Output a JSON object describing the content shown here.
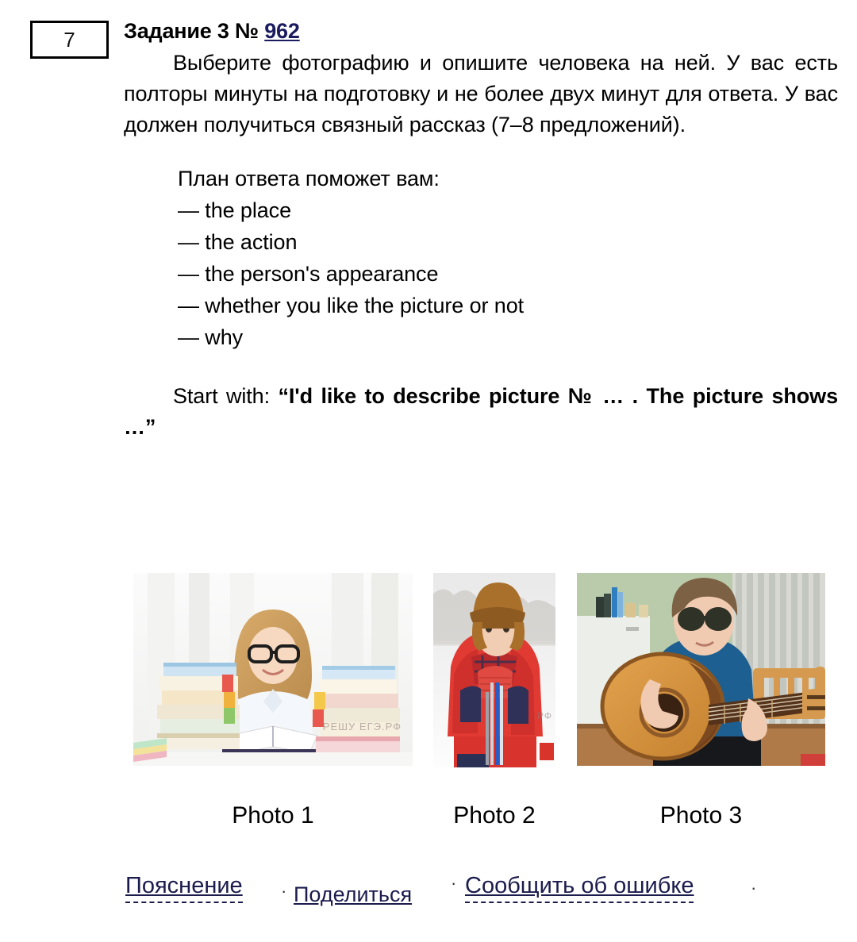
{
  "task": {
    "number_box": "7",
    "heading_prefix": "Задание 3 № ",
    "heading_link": "962",
    "statement": "Выберите фотографию и опишите человека на ней. У вас есть полторы минуты на подготовку и не более двух минут для ответа. У вас должен получить­ся связный рассказ (7–8 предложений).",
    "plan_title": "План ответа поможет вам:",
    "plan_items": [
      "— the place",
      "— the action",
      "— the person's appearance",
      "— whether you like the picture or not",
      "— why"
    ],
    "start_with_label": "Start with: ",
    "start_with_quote": "“I'd like to describe picture № … . The picture shows …”"
  },
  "photos": [
    {
      "caption": "Photo 1",
      "alt": "Girl with glasses reading a book between stacks of books",
      "watermark": "РЕШУ ЕГЭ.РФ"
    },
    {
      "caption": "Photo 2",
      "alt": "Child in red winter jacket and fur hat holding skis in the snow",
      "watermark": ".РФ"
    },
    {
      "caption": "Photo 3",
      "alt": "Boy in blue sweater and sunglasses playing an acoustic guitar",
      "watermark": ""
    }
  ],
  "footer": {
    "explanation": "Пояснение",
    "separator": "·",
    "share": "Поделиться",
    "report": "Сообщить об ошибке"
  },
  "colors": {
    "link": "#1b1b60",
    "footer_link": "#1b1b4d",
    "text": "#000000",
    "background": "#ffffff"
  }
}
